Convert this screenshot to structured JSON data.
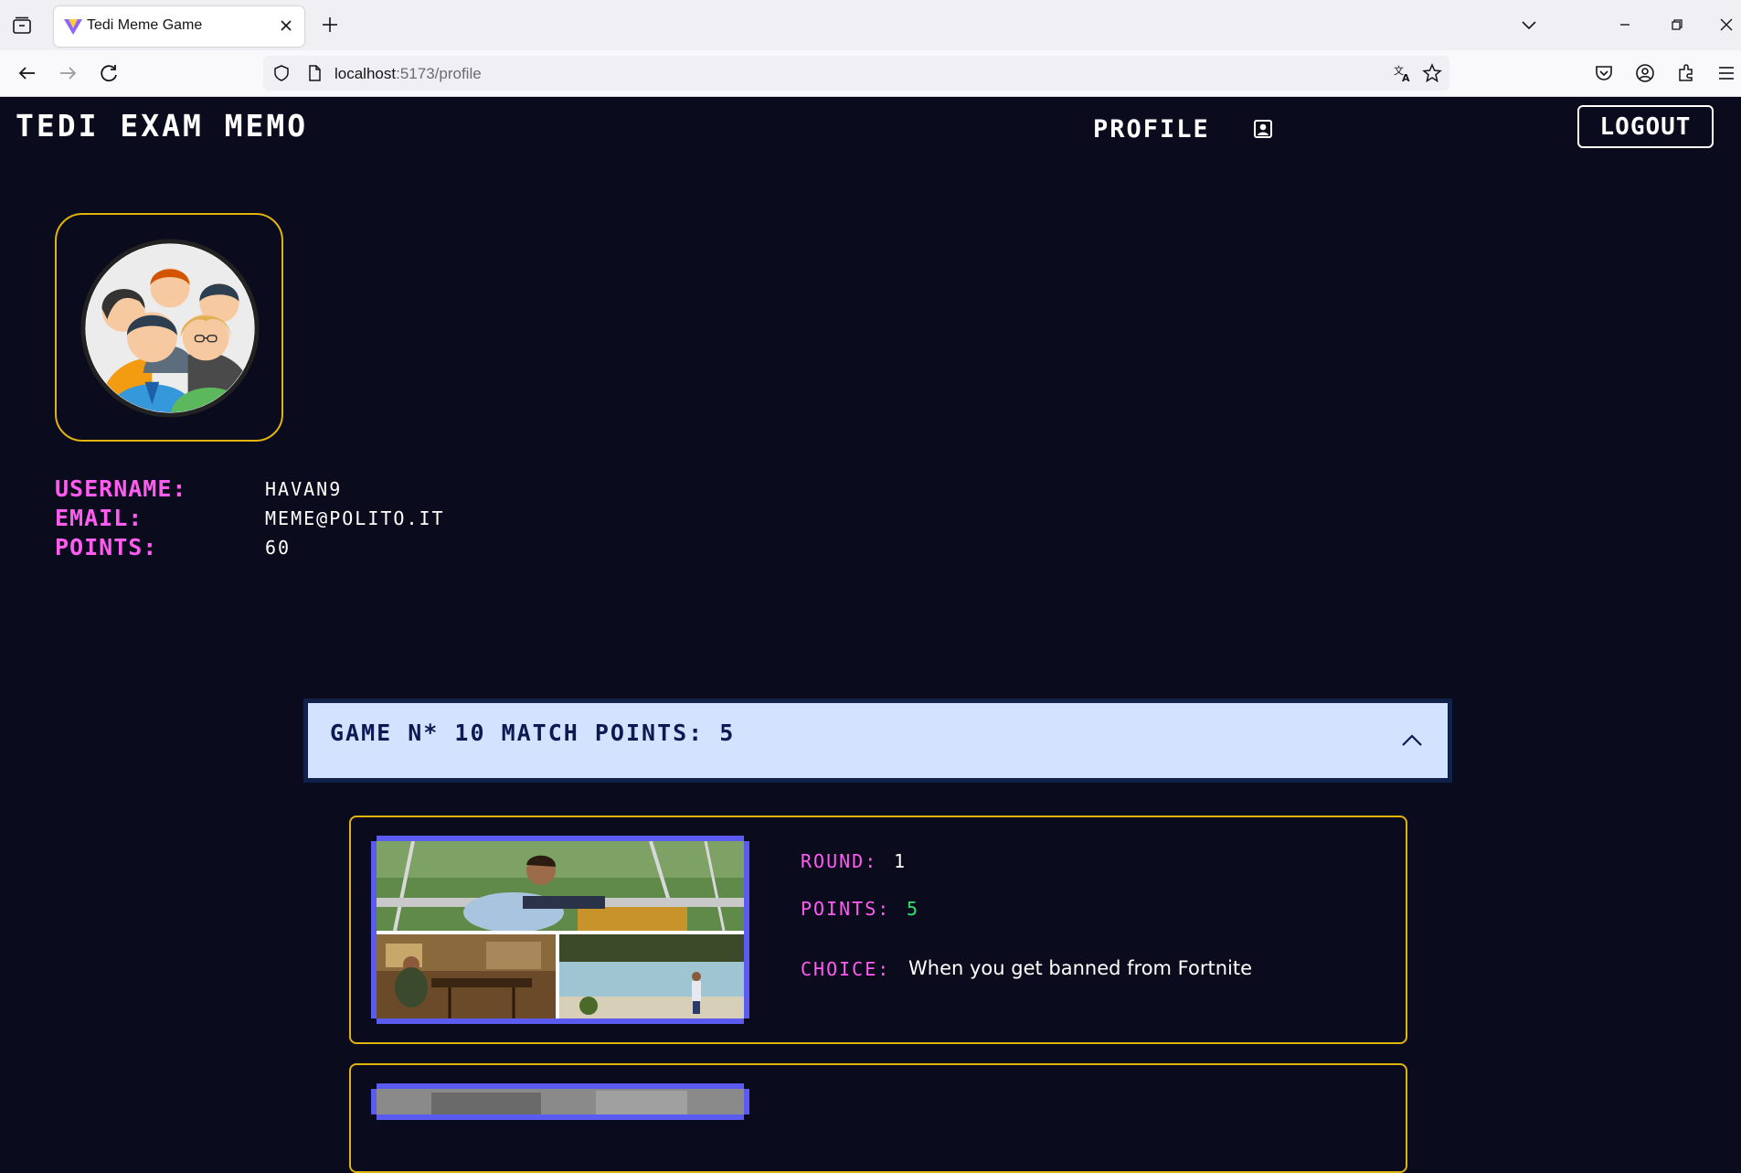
{
  "browser": {
    "tab_title": "Tedi Meme Game",
    "url_host": "localhost",
    "url_rest": ":5173/profile"
  },
  "app": {
    "brand": "TEDI EXAM MEMO",
    "nav_profile": "PROFILE",
    "logout": "LOGOUT"
  },
  "profile": {
    "username_label": "USERNAME:",
    "username": "HAVAN9",
    "email_label": "EMAIL:",
    "email": "MEME@POLITO.IT",
    "points_label": "POINTS:",
    "points": "60"
  },
  "game": {
    "header": "GAME N* 10 MATCH POINTS: 5",
    "expanded": true,
    "rounds": [
      {
        "round_label": "ROUND:",
        "round": "1",
        "points_label": "POINTS:",
        "points": "5",
        "choice_label": "CHOICE:",
        "choice": "When you get banned from Fortnite"
      }
    ]
  },
  "colors": {
    "page_bg": "#0b0b1e",
    "accent_gold": "#e1b40a",
    "label_pink": "#ff5cf0",
    "points_green": "#2ee26a",
    "accordion_bg": "#d2e2ff",
    "frame_blue": "#5b5bf0"
  }
}
